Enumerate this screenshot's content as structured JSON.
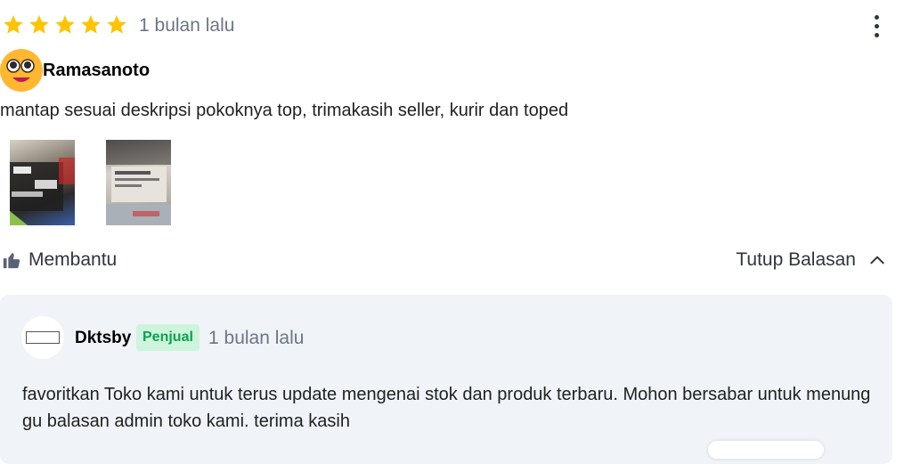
{
  "review": {
    "rating": 5,
    "max_rating": 5,
    "time": "1 bulan lalu",
    "reviewer_name": "Ramasanoto",
    "text": "mantap sesuai deskripsi pokoknya top, trimakasih seller, kurir dan toped",
    "helpful_label": "Membantu",
    "collapse_label": "Tutup Balasan"
  },
  "reply": {
    "seller_name": "Dktsby",
    "badge": "Penjual",
    "time": "1 bulan lalu",
    "text": "favoritkan Toko kami untuk terus update mengenai stok dan produk terbaru. Mohon bersabar untuk menunggu balasan admin toko kami. terima kasih"
  },
  "colors": {
    "star": "#ffc400",
    "badge_bg": "#cdf5dc",
    "badge_text": "#0e9f52",
    "reply_bg": "#f0f3f7",
    "muted_text": "#6d7588"
  },
  "icons": [
    "star-icon",
    "kebab-menu-icon",
    "thumbs-up-icon",
    "chevron-up-icon"
  ]
}
